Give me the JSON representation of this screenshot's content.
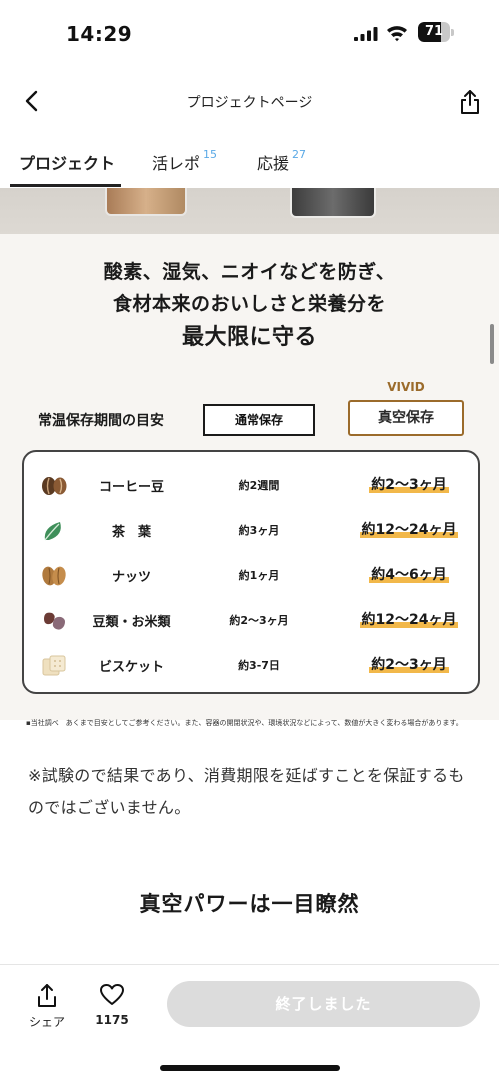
{
  "status_bar": {
    "time": "14:29",
    "battery_level": "71",
    "battery_fraction": 0.71,
    "icons": [
      "signal-icon",
      "wifi-icon",
      "battery-icon"
    ]
  },
  "header": {
    "title": "プロジェクトページ",
    "back_icon": "chevron-left-icon",
    "share_icon": "share-icon"
  },
  "tabs": [
    {
      "label": "プロジェクト",
      "count": "",
      "active": true
    },
    {
      "label": "活レポ",
      "count": "15",
      "active": false
    },
    {
      "label": "応援",
      "count": "27",
      "active": false
    }
  ],
  "content": {
    "headline": {
      "line1": "酸素、湿気、ニオイなどを防ぎ、",
      "line2": "食材本来のおいしさと栄養分を",
      "line3": "最大限に守る"
    },
    "comparison": {
      "label": "常温保存期間の目安",
      "normal_label": "通常保存",
      "vivid_label": "VIVID",
      "vacuum_label": "真空保存",
      "rows": [
        {
          "name": "コーヒー豆",
          "normal": "約2週間",
          "vacuum": "約2〜3ヶ月",
          "icon": "coffee-bean-icon"
        },
        {
          "name": "茶　葉",
          "normal": "約3ヶ月",
          "vacuum": "約12〜24ヶ月",
          "icon": "tea-leaf-icon"
        },
        {
          "name": "ナッツ",
          "normal": "約1ヶ月",
          "vacuum": "約4〜6ヶ月",
          "icon": "nut-icon"
        },
        {
          "name": "豆類・お米類",
          "normal": "約2〜3ヶ月",
          "vacuum": "約12〜24ヶ月",
          "icon": "bean-icon"
        },
        {
          "name": "ビスケット",
          "normal": "約3-7日",
          "vacuum": "約2〜3ヶ月",
          "icon": "biscuit-icon"
        }
      ],
      "accent_color": "#9b6b2b",
      "highlight_color": "#f2b84a"
    },
    "footnote": "▪当社調べ　あくまで目安としてご参考ください。また、容器の開閉状況や、環境状況などによって、数値が大きく変わる場合があります。",
    "disclaimer": "※試験ので結果であり、消費期限を延ばすことを保証するものではございません。",
    "section_heading": "真空パワーは一目瞭然"
  },
  "bottom_bar": {
    "share_label": "シェア",
    "like_count": "1175",
    "ended_label": "終了しました"
  }
}
